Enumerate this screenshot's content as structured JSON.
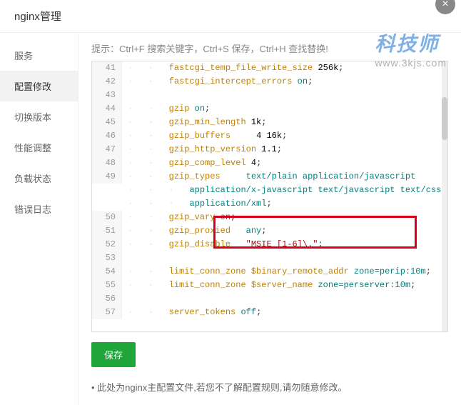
{
  "header": {
    "title": "nginx管理"
  },
  "sidebar": {
    "items": [
      {
        "label": "服务"
      },
      {
        "label": "配置修改"
      },
      {
        "label": "切换版本"
      },
      {
        "label": "性能调整"
      },
      {
        "label": "负载状态"
      },
      {
        "label": "错误日志"
      }
    ]
  },
  "main": {
    "hint": "提示：Ctrl+F 搜索关键字，Ctrl+S 保存，Ctrl+H 查找替换!",
    "save_label": "保存",
    "note": "此处为nginx主配置文件,若您不了解配置规则,请勿随意修改。"
  },
  "watermark": {
    "logo": "科技师",
    "url": "www.3kjs.com"
  },
  "code": {
    "lines": [
      {
        "n": 41,
        "indent": 2,
        "tokens": [
          [
            "dir",
            "fastcgi_temp_file_write_size"
          ],
          [
            "txt",
            " "
          ],
          [
            "num",
            "256k"
          ],
          [
            "txt",
            ";"
          ]
        ]
      },
      {
        "n": 42,
        "indent": 2,
        "tokens": [
          [
            "dir",
            "fastcgi_intercept_errors"
          ],
          [
            "txt",
            " "
          ],
          [
            "kw",
            "on"
          ],
          [
            "txt",
            ";"
          ]
        ]
      },
      {
        "n": 43,
        "indent": 0,
        "tokens": []
      },
      {
        "n": 44,
        "indent": 2,
        "tokens": [
          [
            "dir",
            "gzip"
          ],
          [
            "txt",
            " "
          ],
          [
            "kw",
            "on"
          ],
          [
            "txt",
            ";"
          ]
        ]
      },
      {
        "n": 45,
        "indent": 2,
        "tokens": [
          [
            "dir",
            "gzip_min_length"
          ],
          [
            "txt",
            " "
          ],
          [
            "num",
            "1k"
          ],
          [
            "txt",
            ";"
          ]
        ]
      },
      {
        "n": 46,
        "indent": 2,
        "tokens": [
          [
            "dir",
            "gzip_buffers"
          ],
          [
            "txt",
            "     "
          ],
          [
            "num",
            "4 16k"
          ],
          [
            "txt",
            ";"
          ]
        ]
      },
      {
        "n": 47,
        "indent": 2,
        "tokens": [
          [
            "dir",
            "gzip_http_version"
          ],
          [
            "txt",
            " "
          ],
          [
            "num",
            "1.1"
          ],
          [
            "txt",
            ";"
          ]
        ]
      },
      {
        "n": 48,
        "indent": 2,
        "tokens": [
          [
            "dir",
            "gzip_comp_level"
          ],
          [
            "txt",
            " "
          ],
          [
            "num",
            "4"
          ],
          [
            "txt",
            ";"
          ]
        ]
      },
      {
        "n": 49,
        "indent": 2,
        "tokens": [
          [
            "dir",
            "gzip_types"
          ],
          [
            "txt",
            "     "
          ],
          [
            "val",
            "text/plain application/javascript application/x-javascript text/javascript text/css application/xml"
          ],
          [
            "txt",
            ";"
          ]
        ]
      },
      {
        "n": 50,
        "indent": 2,
        "tokens": [
          [
            "dir",
            "gzip_vary"
          ],
          [
            "txt",
            " "
          ],
          [
            "kw",
            "on"
          ],
          [
            "txt",
            ";"
          ]
        ]
      },
      {
        "n": 51,
        "indent": 2,
        "tokens": [
          [
            "dir",
            "gzip_proxied"
          ],
          [
            "txt",
            "   "
          ],
          [
            "kw",
            "any"
          ],
          [
            "txt",
            ";"
          ]
        ]
      },
      {
        "n": 52,
        "indent": 2,
        "tokens": [
          [
            "dir",
            "gzip_disable"
          ],
          [
            "txt",
            "   "
          ],
          [
            "str",
            "\"MSIE [1-6]\\.\""
          ],
          [
            "txt",
            ";"
          ]
        ]
      },
      {
        "n": 53,
        "indent": 0,
        "tokens": []
      },
      {
        "n": 54,
        "indent": 2,
        "tokens": [
          [
            "dir",
            "limit_conn_zone"
          ],
          [
            "txt",
            " "
          ],
          [
            "var",
            "$binary_remote_addr"
          ],
          [
            "txt",
            " "
          ],
          [
            "val",
            "zone=perip:10m"
          ],
          [
            "txt",
            ";"
          ]
        ]
      },
      {
        "n": 55,
        "indent": 2,
        "tokens": [
          [
            "dir",
            "limit_conn_zone"
          ],
          [
            "txt",
            " "
          ],
          [
            "var",
            "$server_name"
          ],
          [
            "txt",
            " "
          ],
          [
            "val",
            "zone=perserver:10m"
          ],
          [
            "txt",
            ";"
          ]
        ]
      },
      {
        "n": 56,
        "indent": 0,
        "tokens": []
      },
      {
        "n": 57,
        "indent": 2,
        "tokens": [
          [
            "dir",
            "server_tokens"
          ],
          [
            "txt",
            " "
          ],
          [
            "kw",
            "off"
          ],
          [
            "txt",
            ";"
          ]
        ]
      }
    ],
    "wrap_indent": 3
  }
}
